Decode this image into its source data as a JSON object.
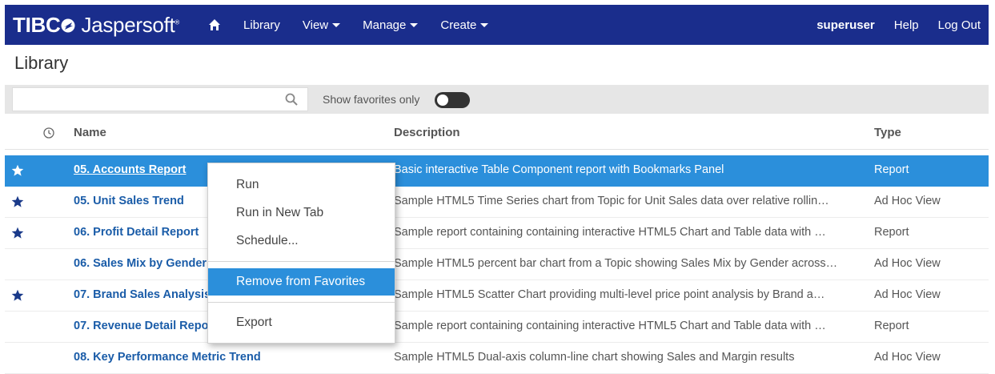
{
  "topbar": {
    "logo_brand": "TIBC",
    "logo_product": "Jaspersoft",
    "nav": [
      {
        "label": "Library",
        "dropdown": false
      },
      {
        "label": "View",
        "dropdown": true
      },
      {
        "label": "Manage",
        "dropdown": true
      },
      {
        "label": "Create",
        "dropdown": true
      }
    ],
    "user": "superuser",
    "help": "Help",
    "logout": "Log Out",
    "bar_color": "#1a2d8c"
  },
  "page": {
    "title": "Library"
  },
  "filter": {
    "search_value": "",
    "favorites_label": "Show favorites only",
    "favorites_only": false
  },
  "table": {
    "columns": {
      "name": "Name",
      "description": "Description",
      "type": "Type"
    },
    "rows": [
      {
        "favorite": true,
        "name": "05. Accounts Report",
        "description": "Basic interactive Table Component report with Bookmarks Panel",
        "type": "Report",
        "selected": true
      },
      {
        "favorite": true,
        "name": "05. Unit Sales Trend",
        "description": "Sample HTML5 Time Series chart from Topic for Unit Sales data over relative rollin…",
        "type": "Ad Hoc View",
        "selected": false
      },
      {
        "favorite": true,
        "name": "06. Profit Detail Report",
        "description": "Sample report containing containing interactive HTML5 Chart and Table data with …",
        "type": "Report",
        "selected": false
      },
      {
        "favorite": false,
        "name": "06. Sales Mix by Gender",
        "description": "Sample HTML5 percent bar chart from a Topic showing Sales Mix by Gender across…",
        "type": "Ad Hoc View",
        "selected": false
      },
      {
        "favorite": true,
        "name": "07. Brand Sales Analysis",
        "description": "Sample HTML5 Scatter Chart providing multi-level price point analysis by Brand a…",
        "type": "Ad Hoc View",
        "selected": false
      },
      {
        "favorite": false,
        "name": "07. Revenue Detail Report",
        "description": "Sample report containing containing interactive HTML5 Chart and Table data with …",
        "type": "Report",
        "selected": false
      },
      {
        "favorite": false,
        "name": "08. Key Performance Metric Trend",
        "description": "Sample HTML5 Dual-axis column-line chart showing Sales and Margin results",
        "type": "Ad Hoc View",
        "selected": false
      }
    ]
  },
  "context_menu": {
    "items": [
      {
        "label": "Run",
        "active": false
      },
      {
        "label": "Run in New Tab",
        "active": false
      },
      {
        "label": "Schedule...",
        "active": false
      },
      {
        "label": "Remove from Favorites",
        "active": true
      },
      {
        "label": "Export",
        "active": false
      }
    ]
  },
  "colors": {
    "accent": "#2b8fdb",
    "link": "#1a5ca8",
    "star": "#1a3a8a"
  }
}
